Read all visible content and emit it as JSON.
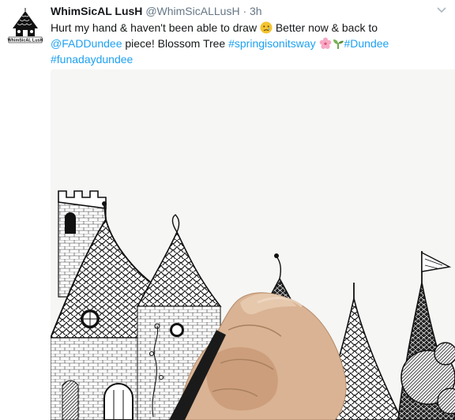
{
  "tweet": {
    "display_name": "WhimSicAL LusH",
    "handle": "@WhimSicALLusH",
    "separator": "·",
    "time": "3h",
    "avatar_text": "WhimSicAL LusH",
    "text": {
      "part1": "Hurt my hand & haven't been able to draw",
      "part2": "Better now & back to",
      "mention": "@FADDundee",
      "part3": "piece! Blossom Tree",
      "hashtag1": "#springisonitsway",
      "hashtag2": "#Dundee",
      "hashtag3": "#funadaydundee"
    },
    "icons": {
      "emoji1": "crying-face-icon",
      "emoji2": "cherry-blossom-icon",
      "emoji3": "seedling-icon",
      "caret": "chevron-down-icon"
    },
    "colors": {
      "link": "#1da1f2",
      "text": "#14171a",
      "meta": "#657786"
    }
  }
}
